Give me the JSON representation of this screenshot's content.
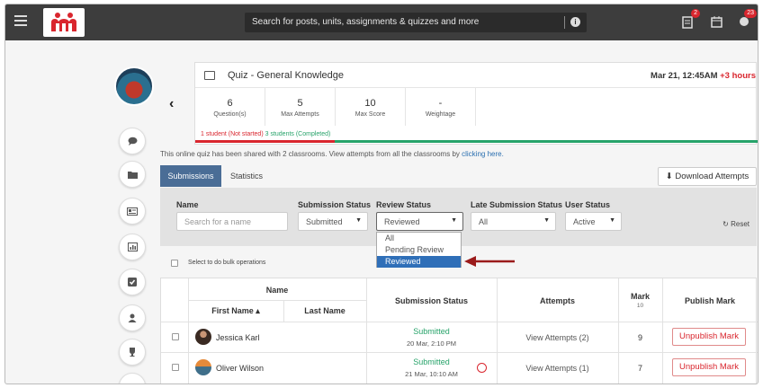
{
  "topbar": {
    "search_placeholder": "Search for posts, units, assignments & quizzes and more",
    "notif_badge": "2",
    "alerts_badge": "23"
  },
  "quiz": {
    "title": "Quiz - General Knowledge",
    "date": "Mar 21, 12:45AM",
    "date_extra": "+3 hours",
    "stats": [
      {
        "value": "6",
        "label": "Question(s)"
      },
      {
        "value": "5",
        "label": "Max Attempts"
      },
      {
        "value": "10",
        "label": "Max Score"
      },
      {
        "value": "-",
        "label": "Weightage"
      }
    ],
    "not_started": "1 student (Not started)",
    "completed": "3 students (Completed)",
    "completed_fraction": 0.75
  },
  "shared_text": "This online quiz has been shared with 2 classrooms. View attempts from all the classrooms by",
  "shared_link": "clicking here.",
  "tabs": {
    "submissions": "Submissions",
    "statistics": "Statistics"
  },
  "download_label": "Download Attempts",
  "filters": {
    "name_label": "Name",
    "name_placeholder": "Search for a name",
    "submission_status_label": "Submission Status",
    "submission_status_value": "Submitted",
    "review_status_label": "Review Status",
    "review_status_value": "Reviewed",
    "late_label": "Late Submission Status",
    "late_value": "All",
    "user_status_label": "User Status",
    "user_status_value": "Active",
    "reset_label": "Reset",
    "review_options": [
      "All",
      "Pending Review",
      "Reviewed"
    ]
  },
  "bulk_text": "Select to do bulk operations",
  "table": {
    "name_header": "Name",
    "first_name": "First Name ▴",
    "last_name": "Last Name",
    "submission_status": "Submission Status",
    "attempts": "Attempts",
    "mark": "Mark",
    "mark_sub": "10",
    "publish_mark": "Publish Mark",
    "rows": [
      {
        "name": "Jessica Karl",
        "status": "Submitted",
        "date": "20 Mar, 2:10 PM",
        "attempts": "View Attempts (2)",
        "mark": "9",
        "action": "Unpublish Mark"
      },
      {
        "name": "Oliver Wilson",
        "status": "Submitted",
        "date": "21 Mar, 10:10 AM",
        "attempts": "View Attempts (1)",
        "mark": "7",
        "action": "Unpublish Mark"
      }
    ]
  },
  "colors": {
    "accent_blue": "#4a6d96",
    "red": "#d9262e",
    "green": "#27a36a",
    "topbar": "#3d3d3d"
  }
}
